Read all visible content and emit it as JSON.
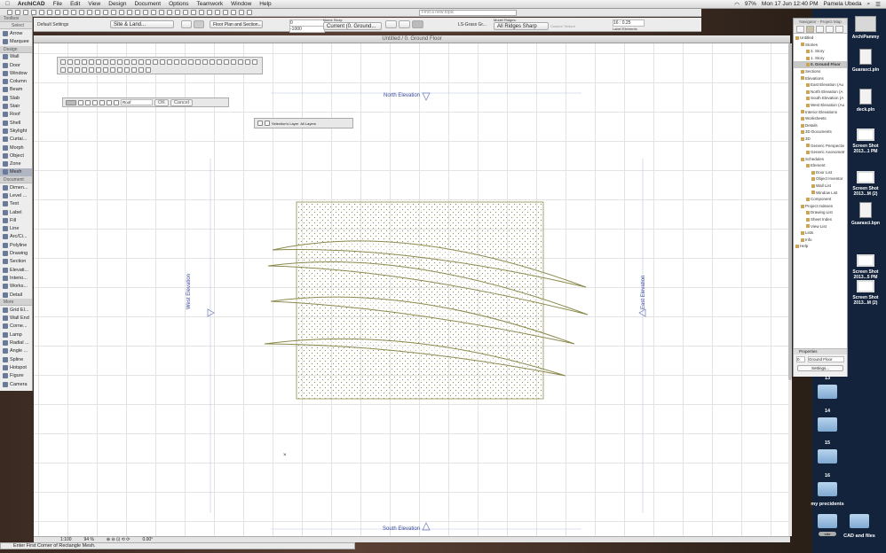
{
  "menubar": {
    "app": "ArchiCAD",
    "items": [
      "File",
      "Edit",
      "View",
      "Design",
      "Document",
      "Options",
      "Teamwork",
      "Window",
      "Help"
    ],
    "battery": "97%",
    "clock": "Mon 17 Jun  12:40 PM",
    "user": "Pamela Ubeda"
  },
  "toolbar": {
    "search_placeholder": "Find a new topic"
  },
  "infobox": {
    "default_settings": "Default Settings",
    "layer": "Site & Land...",
    "floor_plan": "Floor Plan and Section...",
    "offset_top": "0",
    "offset_bottom": "-1000",
    "home_story_label": "Home Story:",
    "home_story": "Current (0. Ground...",
    "material": "LS-Grass Gr...",
    "model_ridges_label": "Model Ridges:",
    "model_ridges": "All Ridges Sharp",
    "custom_texture": "Custom Texture",
    "pen": "16 : 0.25",
    "label_elements": "Label Elements"
  },
  "toolbox": {
    "title": "Toolbox",
    "select_label": "Select",
    "sections": [
      {
        "name": "Select",
        "items": [
          "Arrow",
          "Marquee"
        ]
      },
      {
        "name": "Design",
        "items": [
          "Wall",
          "Door",
          "Window",
          "Column",
          "Beam",
          "Slab",
          "Stair",
          "Roof",
          "Shell",
          "Skylight",
          "Curtai...",
          "Morph",
          "Object",
          "Zone",
          "Mesh"
        ]
      },
      {
        "name": "Document",
        "items": [
          "Dimen...",
          "Level ...",
          "Text",
          "Label",
          "Fill",
          "Line",
          "Arc/Ci...",
          "Polyline",
          "Drawing",
          "Section",
          "Elevati...",
          "Interio...",
          "Works...",
          "Detail"
        ]
      },
      {
        "name": "More",
        "items": [
          "Grid El...",
          "Wall End",
          "Corne...",
          "Lamp",
          "Radial ...",
          "Angle ...",
          "Spline",
          "Hotspot",
          "Figure",
          "Camera"
        ]
      }
    ],
    "selected": "Mesh"
  },
  "window": {
    "title": "Untitled / 0. Ground Floor"
  },
  "drawing": {
    "north": "North Elevation",
    "south": "South Elevation",
    "west": "West Elevation",
    "east": "East Elevation",
    "mesh_color": "#8c8a4e"
  },
  "palette": {
    "ok": "OK",
    "cancel": "Cancel",
    "height_label": "Roof",
    "selections_layer": "Selection's Layer",
    "all_layers": "All Layers"
  },
  "statusbar": {
    "scale": "1:100",
    "zoom": "94 %",
    "angle": "0.00°"
  },
  "message": "Enter First Corner of Rectangle Mesh.",
  "navigator": {
    "title": "Navigator - Project Map",
    "items": [
      {
        "label": "Untitled",
        "level": 0
      },
      {
        "label": "Stories",
        "level": 1
      },
      {
        "label": "2. Story",
        "level": 2
      },
      {
        "label": "1. Story",
        "level": 2
      },
      {
        "label": "0. Ground Floor",
        "level": 2,
        "selected": true
      },
      {
        "label": "Sections",
        "level": 1
      },
      {
        "label": "Elevations",
        "level": 1
      },
      {
        "label": "East Elevation (Au",
        "level": 2
      },
      {
        "label": "North Elevation (A",
        "level": 2
      },
      {
        "label": "South Elevation (A",
        "level": 2
      },
      {
        "label": "West Elevation (Au",
        "level": 2
      },
      {
        "label": "Interior Elevations",
        "level": 1
      },
      {
        "label": "Worksheets",
        "level": 1
      },
      {
        "label": "Details",
        "level": 1
      },
      {
        "label": "3D Documents",
        "level": 1
      },
      {
        "label": "3D",
        "level": 1
      },
      {
        "label": "Generic Perspectiv",
        "level": 2
      },
      {
        "label": "Generic Axonometr",
        "level": 2
      },
      {
        "label": "Schedules",
        "level": 1
      },
      {
        "label": "Element",
        "level": 2
      },
      {
        "label": "Door List",
        "level": 3
      },
      {
        "label": "Object Inventor",
        "level": 3
      },
      {
        "label": "Wall List",
        "level": 3
      },
      {
        "label": "Window List",
        "level": 3
      },
      {
        "label": "Component",
        "level": 2
      },
      {
        "label": "Project Indexes",
        "level": 1
      },
      {
        "label": "Drawing List",
        "level": 2
      },
      {
        "label": "Sheet Index",
        "level": 2
      },
      {
        "label": "View List",
        "level": 2
      },
      {
        "label": "Lists",
        "level": 1
      },
      {
        "label": "Info",
        "level": 1
      },
      {
        "label": "Help",
        "level": 0
      }
    ],
    "properties": {
      "title": "Properties",
      "story_num": "0.",
      "story_name": "Ground Floor",
      "settings": "Settings..."
    }
  },
  "desktop": {
    "files": [
      "ArchiPammy",
      "Guarasci.pln",
      "deck.pln",
      "Screen Shot 2013...1 PM",
      "Screen Shot 2013...M (2)",
      "Guarasci.bpn",
      "Screen Shot 2013...5 PM",
      "Screen Shot 2013...M (2)"
    ],
    "folders": [
      "13",
      "14",
      "15",
      "16",
      "my precidents",
      "site",
      "CAD and files"
    ]
  }
}
